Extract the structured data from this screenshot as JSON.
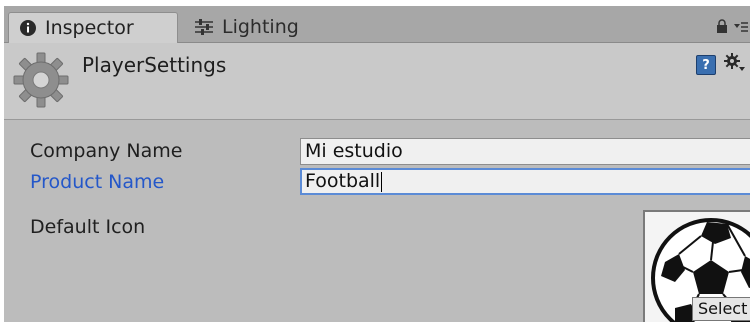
{
  "tabs": [
    {
      "label": "Inspector",
      "icon": "info-icon",
      "active": true
    },
    {
      "label": "Lighting",
      "icon": "sliders-icon",
      "active": false
    }
  ],
  "header": {
    "title": "PlayerSettings",
    "icon": "gear-icon"
  },
  "fields": {
    "company_name": {
      "label": "Company Name",
      "value": "Mi estudio"
    },
    "product_name": {
      "label": "Product Name",
      "value": "Football"
    },
    "default_icon": {
      "label": "Default Icon",
      "select_label": "Select"
    }
  },
  "colors": {
    "highlight_label": "#2457c9",
    "focus_border": "#5b8bd6",
    "panel_bg": "#bcbcbc"
  }
}
